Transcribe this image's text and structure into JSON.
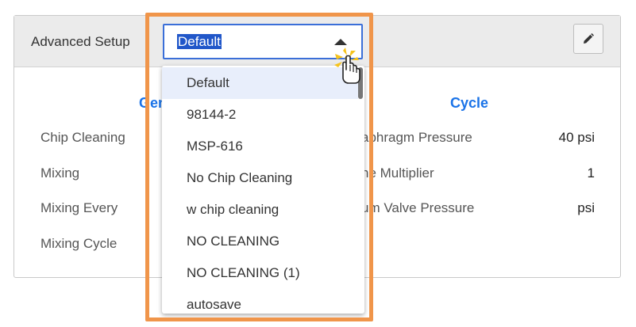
{
  "panel": {
    "title": "Advanced Setup",
    "edit_icon": "pencil-icon"
  },
  "sections": {
    "general_heading_partial": "Gen",
    "cycle_heading": "Cycle"
  },
  "left_rows": [
    {
      "label": "Chip Cleaning"
    },
    {
      "label": "Mixing"
    },
    {
      "label": "Mixing Every"
    },
    {
      "label": "Mixing Cycle"
    }
  ],
  "right_rows": [
    {
      "label_partial": "aphragm Pressure",
      "value": "40 psi"
    },
    {
      "label_partial": "ne Multiplier",
      "value": "1"
    },
    {
      "label_partial": "um Valve Pressure",
      "value": "psi"
    }
  ],
  "select": {
    "value": "Default",
    "caret_icon": "caret-up-icon"
  },
  "dropdown": {
    "options": [
      "Default",
      "98144-2",
      "MSP-616",
      "No Chip Cleaning",
      "w chip cleaning",
      "NO CLEANING",
      "NO CLEANING (1)",
      "autosave"
    ],
    "selected_index": 0
  },
  "colors": {
    "accent_blue": "#1a73e8",
    "highlight_orange": "#f0954a",
    "selection_bg": "#2157c9"
  }
}
